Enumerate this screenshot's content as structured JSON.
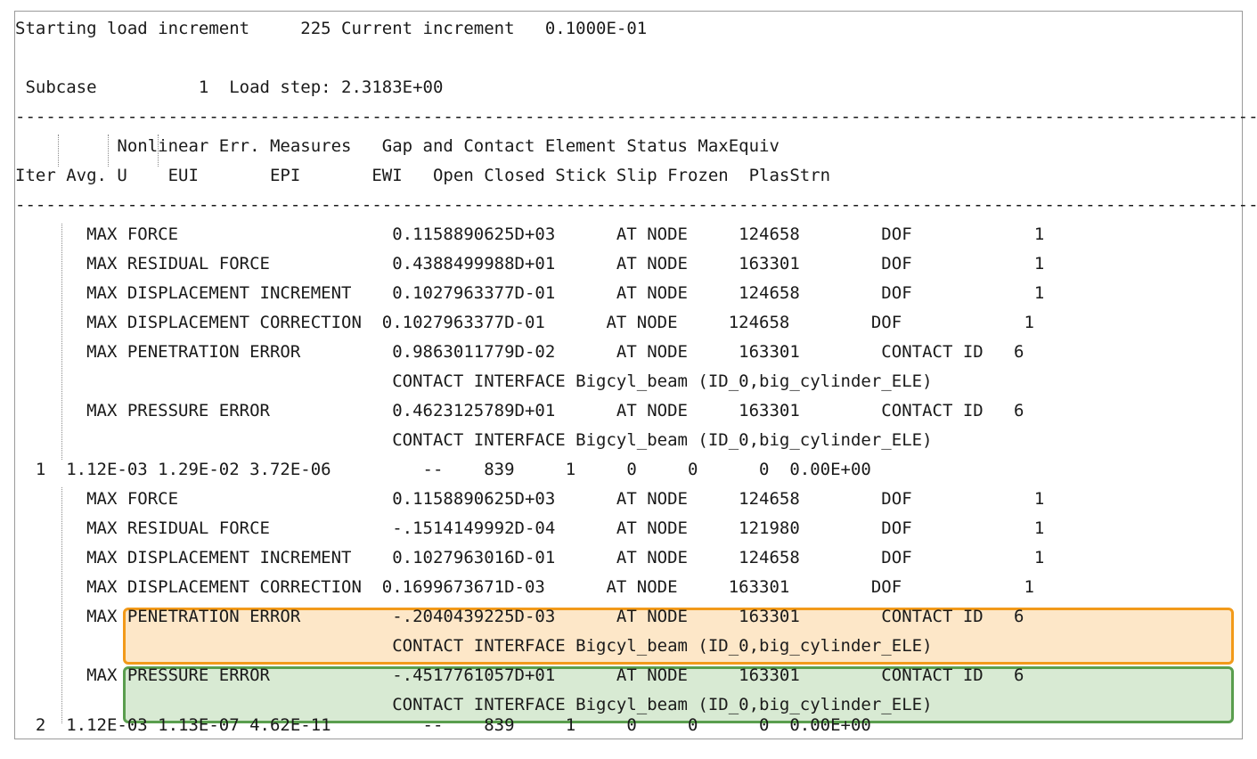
{
  "colors": {
    "text": "#1a1a1a",
    "highlight_penetration_fill": "#fde7c8",
    "highlight_penetration_border": "#f29a1a",
    "highlight_pressure_fill": "#d8ead3",
    "highlight_pressure_border": "#5a9e4e"
  },
  "lines": [
    "Starting load increment     225 Current increment   0.1000E-01",
    "",
    " Subcase          1  Load step: 2.3183E+00",
    "-------------------------------------------------------------------------------------------------------------------------------",
    "          Nonlinear Err. Measures   Gap and Contact Element Status MaxEquiv",
    "Iter Avg. U    EUI       EPI       EWI   Open Closed Stick Slip Frozen  PlasStrn",
    "-------------------------------------------------------------------------------------------------------------------------------",
    "       MAX FORCE                     0.1158890625D+03      AT NODE     124658        DOF            1",
    "       MAX RESIDUAL FORCE            0.4388499988D+01      AT NODE     163301        DOF            1",
    "       MAX DISPLACEMENT INCREMENT    0.1027963377D-01      AT NODE     124658        DOF            1",
    "       MAX DISPLACEMENT CORRECTION  0.1027963377D-01      AT NODE     124658        DOF            1",
    "       MAX PENETRATION ERROR         0.9863011779D-02      AT NODE     163301        CONTACT ID   6",
    "                                     CONTACT INTERFACE Bigcyl_beam (ID_0,big_cylinder_ELE)",
    "       MAX PRESSURE ERROR            0.4623125789D+01      AT NODE     163301        CONTACT ID   6",
    "                                     CONTACT INTERFACE Bigcyl_beam (ID_0,big_cylinder_ELE)",
    "  1  1.12E-03 1.29E-02 3.72E-06         --    839     1     0     0      0  0.00E+00",
    "       MAX FORCE                     0.1158890625D+03      AT NODE     124658        DOF            1",
    "       MAX RESIDUAL FORCE            -.1514149992D-04      AT NODE     121980        DOF            1",
    "       MAX DISPLACEMENT INCREMENT    0.1027963016D-01      AT NODE     124658        DOF            1",
    "       MAX DISPLACEMENT CORRECTION  0.1699673671D-03      AT NODE     163301        DOF            1",
    "       MAX PENETRATION ERROR         -.2040439225D-03      AT NODE     163301        CONTACT ID   6",
    "                                     CONTACT INTERFACE Bigcyl_beam (ID_0,big_cylinder_ELE)",
    "       MAX PRESSURE ERROR            -.4517761057D+01      AT NODE     163301        CONTACT ID   6",
    "                                     CONTACT INTERFACE Bigcyl_beam (ID_0,big_cylinder_ELE)",
    "  2  1.12E-03 1.13E-07 4.62E-11         --    839     1     0     0      0  0.00E+00"
  ]
}
